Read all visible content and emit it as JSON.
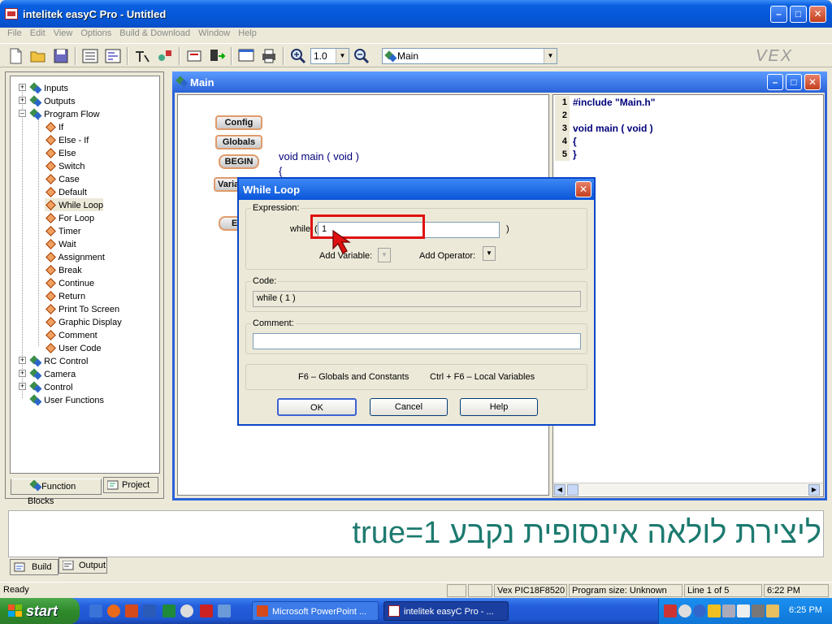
{
  "window": {
    "title": "intelitek easyC Pro - Untitled"
  },
  "menu": [
    "File",
    "Edit",
    "View",
    "Options",
    "Build & Download",
    "Window",
    "Help"
  ],
  "toolbar": {
    "zoom_value": "1.0",
    "function_select": "Main",
    "brand": "VEX"
  },
  "tree": {
    "groups_top": [
      "Inputs",
      "Outputs",
      "Program Flow"
    ],
    "program_flow_items": [
      "If",
      "Else - If",
      "Else",
      "Switch",
      "Case",
      "Default",
      "While Loop",
      "For Loop",
      "Timer",
      "Wait",
      "Assignment",
      "Break",
      "Continue",
      "Return",
      "Print To Screen",
      "Graphic Display",
      "Comment",
      "User Code"
    ],
    "groups_bottom": [
      "RC Control",
      "Camera",
      "Control",
      "User Functions"
    ]
  },
  "left_tabs": [
    "Function Blocks",
    "Project"
  ],
  "main_window": {
    "title": "Main"
  },
  "flow_blocks": [
    "Config",
    "Globals",
    "BEGIN",
    "Varia",
    "E"
  ],
  "flow_code": {
    "signature": "void main ( void )",
    "brace": "{"
  },
  "code_lines": [
    {
      "num": "1",
      "text": "#include \"Main.h\""
    },
    {
      "num": "2",
      "text": ""
    },
    {
      "num": "3",
      "text": "void main ( void )"
    },
    {
      "num": "4",
      "text": "{"
    },
    {
      "num": "5",
      "text": "}"
    }
  ],
  "dialog": {
    "title": "While Loop",
    "expression_label": "Expression:",
    "while_label": "while",
    "open_paren": "(",
    "close_paren": ")",
    "expression_value": "1",
    "add_variable_label": "Add Variable:",
    "add_operator_label": "Add Operator:",
    "code_label": "Code:",
    "code_value": "while ( 1 )",
    "comment_label": "Comment:",
    "comment_value": "",
    "hint_globals": "F6 – Globals and Constants",
    "hint_locals": "Ctrl + F6 – Local Variables",
    "ok": "OK",
    "cancel": "Cancel",
    "help": "Help"
  },
  "caption": "ליצירת לולאה אינסופית נקבע true=1",
  "bottom_tabs": [
    "Build",
    "Output"
  ],
  "status": {
    "ready": "Ready",
    "target": "Vex  PIC18F8520",
    "program_size": "Program size: Unknown",
    "line": "Line    1  of    5",
    "time": "6:22 PM"
  },
  "taskbar": {
    "start": "start",
    "tasks": [
      "Microsoft PowerPoint ...",
      "intelitek easyC Pro - ..."
    ],
    "clock": "6:25 PM"
  },
  "colors": {
    "title_blue": "#0a5fe0",
    "caption_text": "#1d7a6f",
    "highlight_red": "#e01010",
    "code_blue": "#00007a"
  }
}
